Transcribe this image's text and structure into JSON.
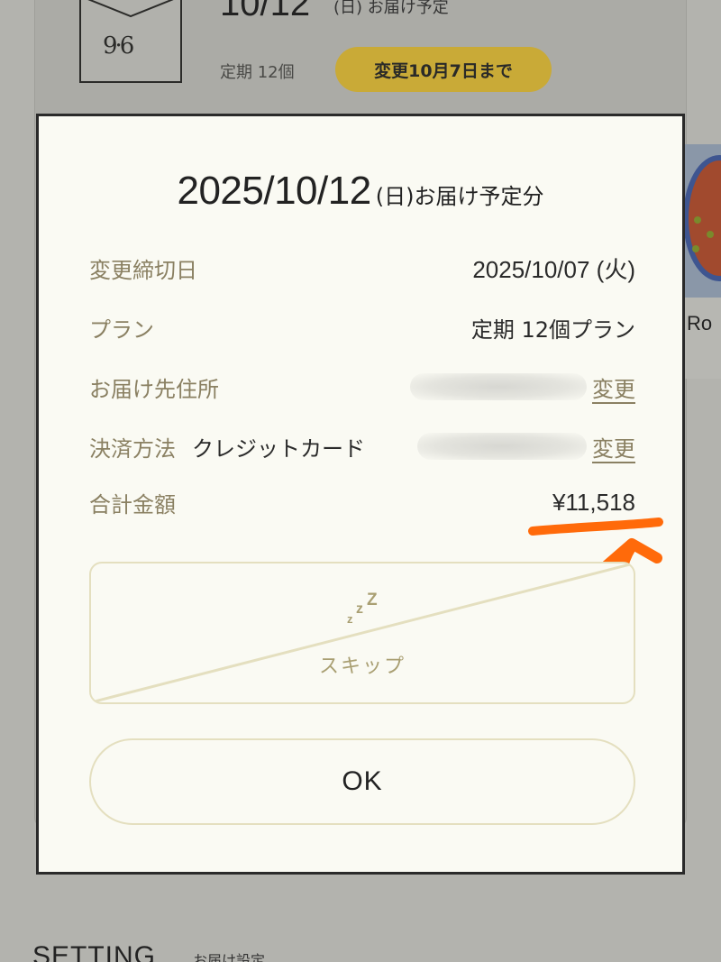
{
  "background": {
    "date": "10/12",
    "date_sub": "(日) お届け予定",
    "plan": "定期 12個",
    "change_button": "変更10月7日まで",
    "side_text": "Ro",
    "setting": "SETTING",
    "setting_sub": "お届け設定"
  },
  "modal": {
    "title_date": "2025/10/12",
    "title_suffix": "(日)お届け予定分",
    "rows": {
      "deadline": {
        "label": "変更締切日",
        "value": "2025/10/07 (火)"
      },
      "plan": {
        "label": "プラン",
        "value": "定期 12個プラン"
      },
      "address": {
        "label": "お届け先住所",
        "change": "変更"
      },
      "payment": {
        "label": "決済方法",
        "value": "クレジットカード",
        "change": "変更"
      },
      "total": {
        "label": "合計金額",
        "value": "¥11,518"
      }
    },
    "skip_button": {
      "icon": "zzz-icon",
      "label": "スキップ"
    },
    "ok_button": {
      "label": "OK"
    }
  },
  "colors": {
    "accent_gold": "#c9aa37",
    "label_olive": "#8a8062",
    "annotation_orange": "#ff6a0a"
  }
}
